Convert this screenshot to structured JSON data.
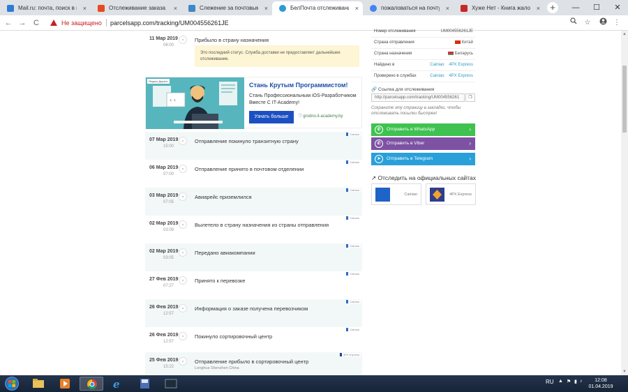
{
  "browser": {
    "tabs": [
      {
        "title": "Mail.ru: почта, поиск в инт",
        "icon_color": "#2d7bd6",
        "active": false
      },
      {
        "title": "Отслеживание заказа",
        "icon_color": "#e8491d",
        "active": false
      },
      {
        "title": "Слежение за почтовыми",
        "icon_color": "#3f88c5",
        "active": false
      },
      {
        "title": "БелПочта отслеживание",
        "icon_color": "#2b9bd8",
        "active": true
      },
      {
        "title": "пожаловаться на почту Р",
        "icon_color": "#4285f4",
        "active": false
      },
      {
        "title": "Хуже Нет - Книга жалоб",
        "icon_color": "#c62828",
        "active": false
      }
    ],
    "new_tab": "+",
    "minimize": "—",
    "maximize": "☐",
    "close": "✕",
    "tab_close": "×",
    "nav": {
      "back": "←",
      "forward": "→",
      "reload": "C"
    },
    "security_label": "Не защищено",
    "url": "parcelsapp.com/tracking/UM004556261JE",
    "search_icon": "search-icon",
    "bookmark_icon": "star-icon",
    "account_icon": "account-icon",
    "menu_icon": "menu-icon"
  },
  "tracking": {
    "first_event": {
      "date": "11 Мар 2019",
      "time": "08:00",
      "text": "Прибыло в страну назначения"
    },
    "notice": "Это последний статус. Служба доставки не предоставляет дальнейшее отслеживание.",
    "events": [
      {
        "date": "07 Мар 2019",
        "time": "15:00",
        "text": "Отправление покинуло транзитную страну",
        "sub": "",
        "badge": "Cainiao"
      },
      {
        "date": "06 Мар 2019",
        "time": "07:00",
        "text": "Отправление принято в почтовом отделении",
        "sub": "",
        "badge": "Cainiao"
      },
      {
        "date": "03 Мар 2019",
        "time": "07:05",
        "text": "Авиарейс приземлился",
        "sub": "",
        "badge": "Cainiao"
      },
      {
        "date": "02 Мар 2019",
        "time": "03:09",
        "text": "Вылетело в страну назначения из страны отправления",
        "sub": "",
        "badge": "Cainiao"
      },
      {
        "date": "02 Мар 2019",
        "time": "03:05",
        "text": "Передано авиакомпании",
        "sub": "",
        "badge": "Cainiao"
      },
      {
        "date": "27 Фев 2019",
        "time": "07:27",
        "text": "Принято к перевозке",
        "sub": "",
        "badge": "Cainiao"
      },
      {
        "date": "26 Фев 2019",
        "time": "12:57",
        "text": "Информация о заказе получена перевозчиком",
        "sub": "",
        "badge": "Cainiao"
      },
      {
        "date": "26 Фев 2019",
        "time": "12:57",
        "text": "Покинуло сортировочный центр",
        "sub": "",
        "badge": "Cainiao"
      },
      {
        "date": "25 Фев 2019",
        "time": "15:22",
        "text": "Отправление прибыло в сортировочный центр",
        "sub": "Longhua Shenzhen China",
        "badge": "4PX Express"
      }
    ]
  },
  "ad": {
    "tag": "Яндекс.Директ",
    "title": "Стань Крутым Программистом!",
    "text": "Стань Профессиональным iOS-Разработчиком Вместе С IT-Academy!",
    "button": "Узнать больше",
    "url": "grodno.it-academy.by"
  },
  "details": {
    "rows": [
      {
        "label": "Номер отслеживания",
        "value": "UM004556261JE"
      },
      {
        "label": "Страна отправления",
        "value": "Китай",
        "flag": "#de2910"
      },
      {
        "label": "Страна назначения",
        "value": "Беларусь",
        "flag": "#c8313e"
      },
      {
        "label": "Найдено в",
        "value": "Cainiao",
        "value2": "4PX Express"
      },
      {
        "label": "Проверено в службах",
        "value": "Cainiao",
        "value2": "4PX Express"
      }
    ],
    "link_label": "Ссылка для отслеживания",
    "link_value": "http://parcelsapp.com/tracking/UM004556261",
    "copy_icon": "copy-icon",
    "save_hint": "Сохраните эту страницу в закладки, чтобы отслеживать посылки быстрее!"
  },
  "share": [
    {
      "label": "Отправить в WhatsApp",
      "color": "#3fc250",
      "icon": "whatsapp-icon",
      "glyph": "✆"
    },
    {
      "label": "Отправить в Viber",
      "color": "#7d52a3",
      "icon": "viber-icon",
      "glyph": "✆"
    },
    {
      "label": "Отправить в Telegram",
      "color": "#2aa0d9",
      "icon": "telegram-icon",
      "glyph": "➤"
    }
  ],
  "official": {
    "title": "Отследить на официальных сайтах",
    "sites": [
      {
        "name": "Cainiao",
        "logo_color": "#1e63c7"
      },
      {
        "name": "4PX Express",
        "logo_color": "#2f3e8c"
      }
    ]
  },
  "taskbar": {
    "lang": "RU",
    "time": "12:08",
    "date": "01.04.2019"
  }
}
